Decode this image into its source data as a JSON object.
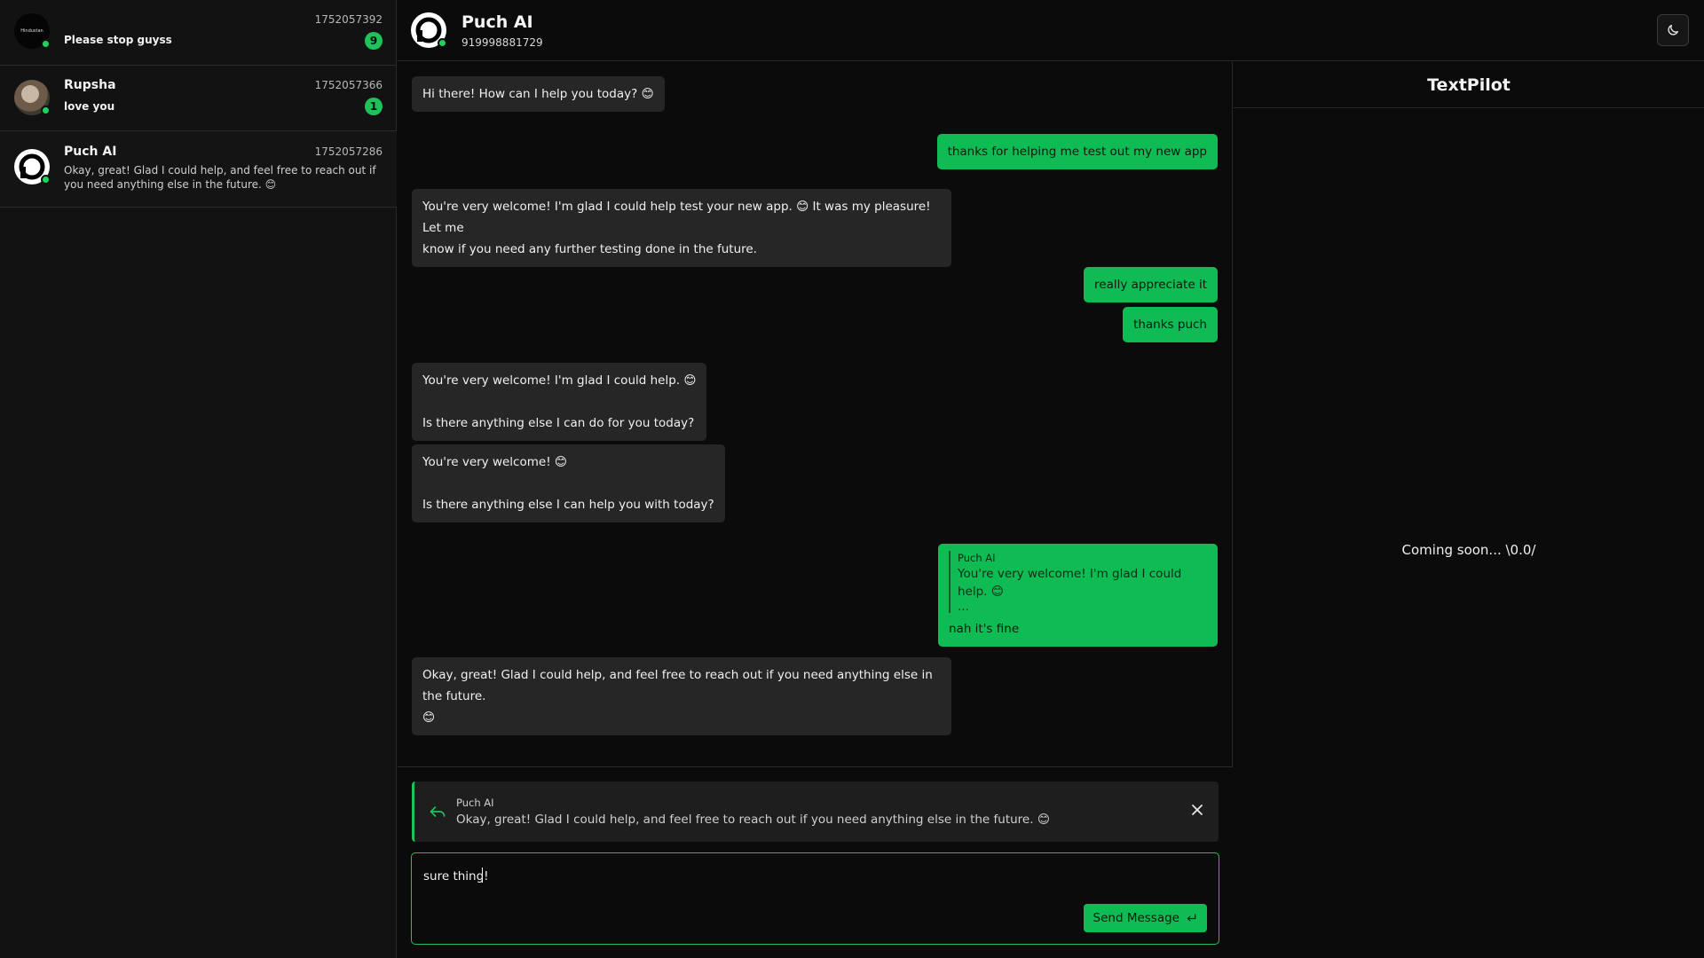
{
  "sidebar": {
    "conversations": [
      {
        "name": "",
        "avatar_text": "Hindustan",
        "timestamp": "1752057392",
        "preview": "Please stop guyss",
        "unread": "9"
      },
      {
        "name": "Rupsha",
        "timestamp": "1752057366",
        "preview": "love you",
        "unread": "1"
      },
      {
        "name": "Puch AI",
        "timestamp": "1752057286",
        "preview": "Okay, great! Glad I could help, and feel free to reach out if you need anything else in the future. 😊"
      }
    ]
  },
  "header": {
    "name": "Puch AI",
    "phone": "919998881729"
  },
  "messages": [
    {
      "dir": "in",
      "lines": [
        "Hi there! How can I help you today? 😊"
      ]
    },
    {
      "dir": "out",
      "lines": [
        "thanks for helping me test out my new app"
      ]
    },
    {
      "dir": "in",
      "lines": [
        "You're very welcome! I'm glad I could help test your new app. 😊 It was my pleasure! Let me",
        "know if you need any further testing done in the future."
      ]
    },
    {
      "dir": "out",
      "lines": [
        "really appreciate it"
      ]
    },
    {
      "dir": "out",
      "lines": [
        "thanks puch"
      ]
    },
    {
      "dir": "in",
      "lines": [
        "You're very welcome! I'm glad I could help. 😊",
        "",
        "Is there anything else I can do for you today?"
      ]
    },
    {
      "dir": "in",
      "lines": [
        "You're very welcome! 😊",
        "",
        "Is there anything else I can help you with today?"
      ]
    },
    {
      "dir": "out",
      "quote_author": "Puch AI",
      "quote_text": "You're very welcome! I'm glad I could help. 😊",
      "quote_more": "...",
      "lines": [
        "nah it's fine"
      ]
    },
    {
      "dir": "in",
      "lines": [
        "Okay, great! Glad I could help, and feel free to reach out if you need anything else in the future.",
        "😊"
      ]
    }
  ],
  "reply": {
    "author": "Puch AI",
    "text": "Okay, great! Glad I could help, and feel free to reach out if you need anything else in the future. 😊"
  },
  "composer": {
    "value": "sure thing!",
    "send_label": "Send Message"
  },
  "right_panel": {
    "title": "TextPilot",
    "body": "Coming soon... \\0.0/"
  },
  "colors": {
    "accent": "#0ebc53",
    "bubble_in": "#262626",
    "background": "#0b0b0b"
  }
}
